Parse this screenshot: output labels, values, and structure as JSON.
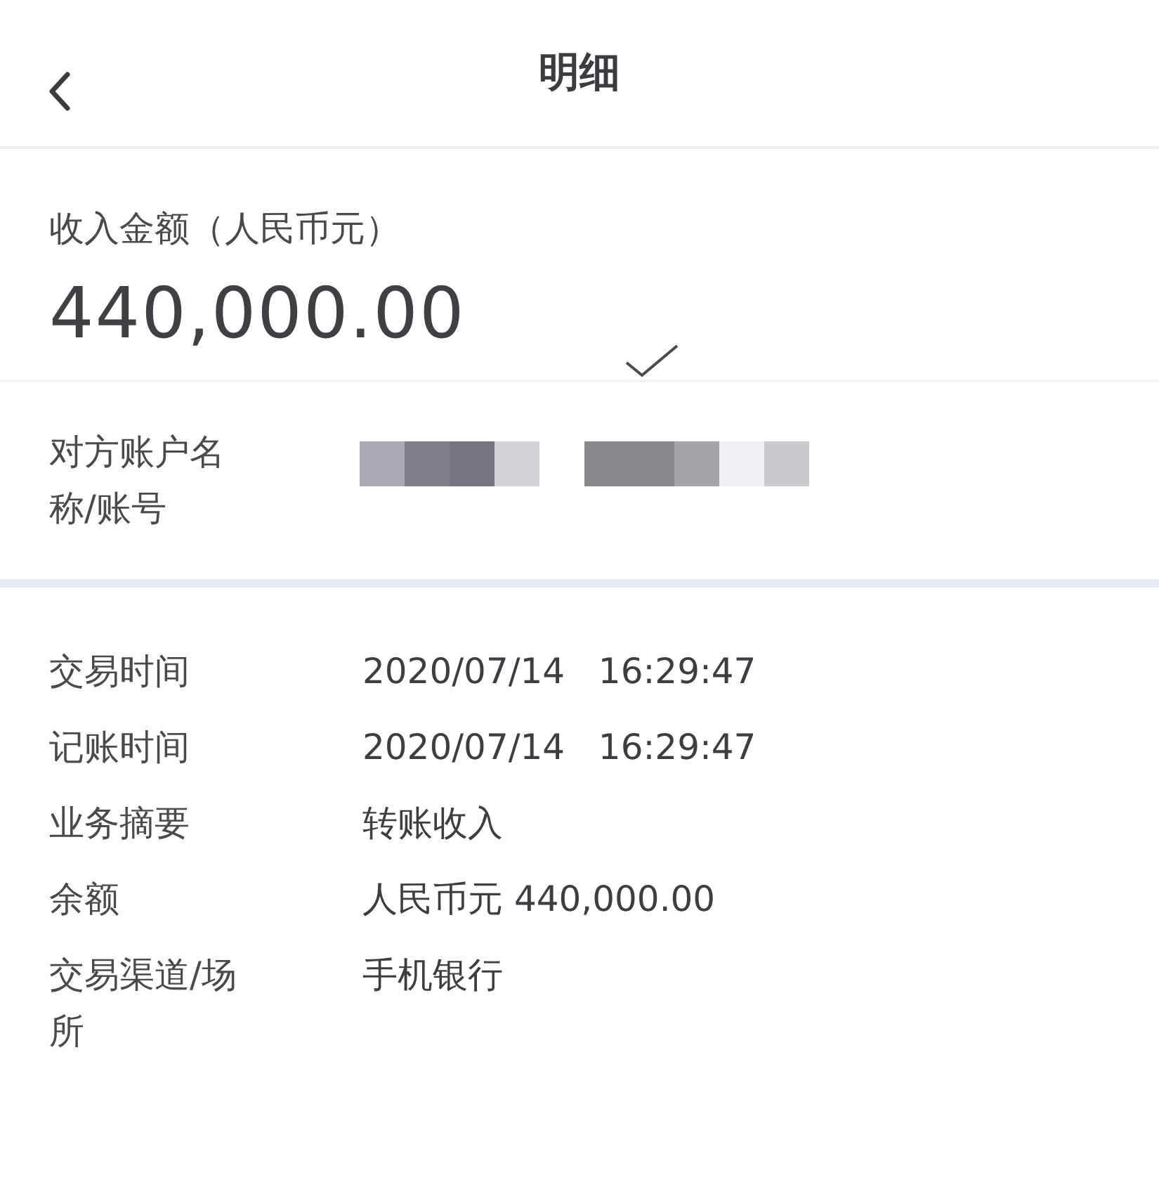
{
  "header": {
    "title": "明细"
  },
  "amount": {
    "label": "收入金额（人民币元）",
    "value": "440,000.00"
  },
  "counterparty": {
    "label": "对方账户名称/账号"
  },
  "details": [
    {
      "label": "交易时间",
      "value": "2020/07/14   16:29:47"
    },
    {
      "label": "记账时间",
      "value": "2020/07/14   16:29:47"
    },
    {
      "label": "业务摘要",
      "value": "转账收入"
    },
    {
      "label": "余额",
      "value": "人民币元 440,000.00"
    },
    {
      "label": "交易渠道/场所",
      "value": "手机银行"
    }
  ]
}
